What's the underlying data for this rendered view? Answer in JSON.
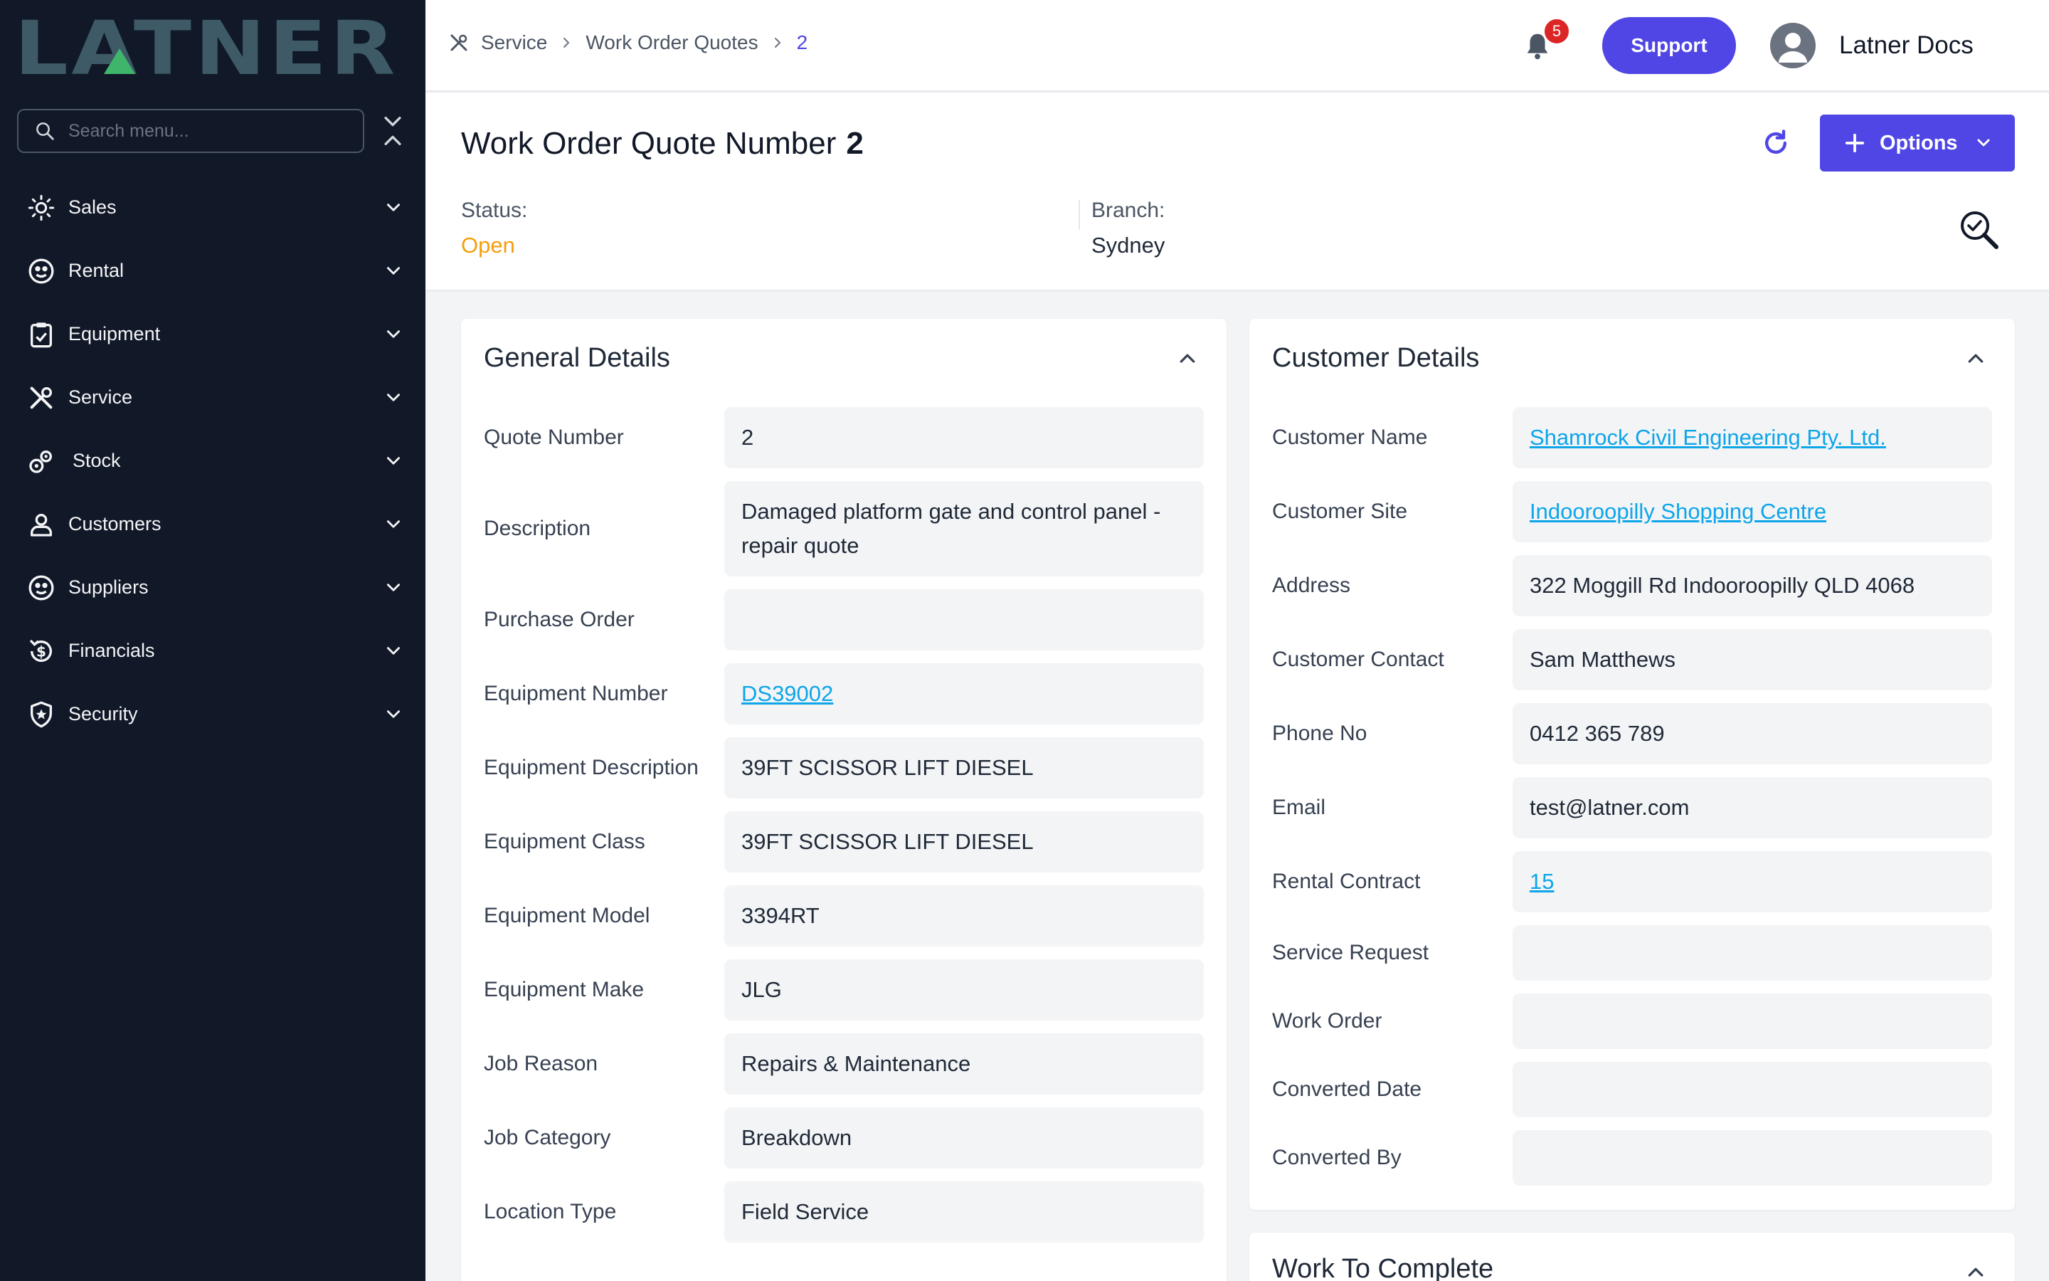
{
  "brand": {
    "logo_text": "LATNER"
  },
  "sidebar": {
    "search_placeholder": "Search menu...",
    "items": [
      {
        "label": "Sales",
        "icon": "sales-icon"
      },
      {
        "label": "Rental",
        "icon": "rental-icon"
      },
      {
        "label": "Equipment",
        "icon": "equipment-icon"
      },
      {
        "label": "Service",
        "icon": "service-icon"
      },
      {
        "label": "Stock",
        "icon": "stock-icon"
      },
      {
        "label": "Customers",
        "icon": "customers-icon"
      },
      {
        "label": "Suppliers",
        "icon": "suppliers-icon"
      },
      {
        "label": "Financials",
        "icon": "financials-icon"
      },
      {
        "label": "Security",
        "icon": "security-icon"
      }
    ]
  },
  "topbar": {
    "breadcrumb": [
      "Service",
      "Work Order Quotes",
      "2"
    ],
    "notification_count": "5",
    "support_label": "Support",
    "user_name": "Latner Docs"
  },
  "header": {
    "title": "Work Order Quote Number",
    "number": "2",
    "options_label": "Options",
    "status_label": "Status:",
    "status_value": "Open",
    "branch_label": "Branch:",
    "branch_value": "Sydney"
  },
  "general": {
    "title": "General Details",
    "rows": [
      {
        "label": "Quote Number",
        "value": "2"
      },
      {
        "label": "Description",
        "value": "Damaged platform gate and control panel - repair quote"
      },
      {
        "label": "Purchase Order",
        "value": ""
      },
      {
        "label": "Equipment Number",
        "value": "DS39002"
      },
      {
        "label": "Equipment Description",
        "value": "39FT SCISSOR LIFT DIESEL"
      },
      {
        "label": "Equipment Class",
        "value": "39FT SCISSOR LIFT DIESEL"
      },
      {
        "label": "Equipment Model",
        "value": "3394RT"
      },
      {
        "label": "Equipment Make",
        "value": "JLG"
      },
      {
        "label": "Job Reason",
        "value": "Repairs & Maintenance"
      },
      {
        "label": "Job Category",
        "value": "Breakdown"
      },
      {
        "label": "Location Type",
        "value": "Field Service"
      }
    ]
  },
  "customer": {
    "title": "Customer Details",
    "rows": [
      {
        "label": "Customer Name",
        "value": "Shamrock Civil Engineering Pty. Ltd."
      },
      {
        "label": "Customer Site",
        "value": "Indooroopilly Shopping Centre"
      },
      {
        "label": "Address",
        "value": "322 Moggill Rd Indooroopilly QLD 4068"
      },
      {
        "label": "Customer Contact",
        "value": "Sam Matthews"
      },
      {
        "label": "Phone No",
        "value": "0412 365 789"
      },
      {
        "label": "Email",
        "value": "test@latner.com"
      },
      {
        "label": "Rental Contract",
        "value": "15"
      },
      {
        "label": "Service Request",
        "value": ""
      },
      {
        "label": "Work Order",
        "value": ""
      },
      {
        "label": "Converted Date",
        "value": ""
      },
      {
        "label": "Converted By",
        "value": ""
      }
    ]
  },
  "work": {
    "title": "Work To Complete"
  },
  "colors": {
    "accent": "#4f46e5",
    "status_open": "#f59e0b",
    "link": "#0ea5e9",
    "sidebar_bg": "#111827"
  }
}
